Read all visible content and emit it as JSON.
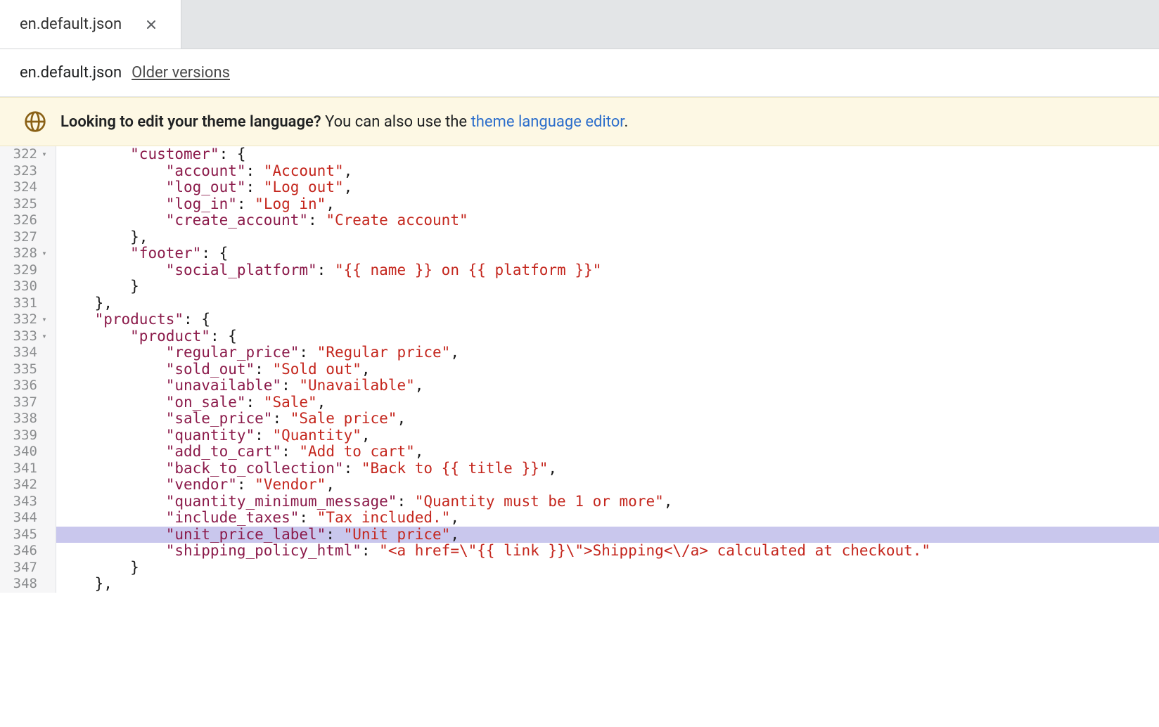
{
  "tab": {
    "label": "en.default.json"
  },
  "breadcrumb": {
    "filename": "en.default.json",
    "older_versions": "Older versions"
  },
  "banner": {
    "strong": "Looking to edit your theme language?",
    "text": " You can also use the ",
    "link": "theme language editor",
    "after": "."
  },
  "editor": {
    "first_line": 322,
    "foldable_lines": [
      322,
      328,
      332,
      333
    ],
    "highlighted_line": 345,
    "lines": [
      {
        "indent": 4,
        "tokens": [
          [
            "key",
            "\"customer\""
          ],
          [
            "pun",
            ": "
          ],
          [
            "pun",
            "{"
          ]
        ]
      },
      {
        "indent": 6,
        "tokens": [
          [
            "key",
            "\"account\""
          ],
          [
            "pun",
            ": "
          ],
          [
            "str",
            "\"Account\""
          ],
          [
            "pun",
            ","
          ]
        ]
      },
      {
        "indent": 6,
        "tokens": [
          [
            "key",
            "\"log_out\""
          ],
          [
            "pun",
            ": "
          ],
          [
            "str",
            "\"Log out\""
          ],
          [
            "pun",
            ","
          ]
        ]
      },
      {
        "indent": 6,
        "tokens": [
          [
            "key",
            "\"log_in\""
          ],
          [
            "pun",
            ": "
          ],
          [
            "str",
            "\"Log in\""
          ],
          [
            "pun",
            ","
          ]
        ]
      },
      {
        "indent": 6,
        "tokens": [
          [
            "key",
            "\"create_account\""
          ],
          [
            "pun",
            ": "
          ],
          [
            "str",
            "\"Create account\""
          ]
        ]
      },
      {
        "indent": 4,
        "tokens": [
          [
            "pun",
            "},"
          ]
        ]
      },
      {
        "indent": 4,
        "tokens": [
          [
            "key",
            "\"footer\""
          ],
          [
            "pun",
            ": "
          ],
          [
            "pun",
            "{"
          ]
        ]
      },
      {
        "indent": 6,
        "tokens": [
          [
            "key",
            "\"social_platform\""
          ],
          [
            "pun",
            ": "
          ],
          [
            "str",
            "\"{{ name }} on {{ platform }}\""
          ]
        ]
      },
      {
        "indent": 4,
        "tokens": [
          [
            "pun",
            "}"
          ]
        ]
      },
      {
        "indent": 2,
        "tokens": [
          [
            "pun",
            "},"
          ]
        ]
      },
      {
        "indent": 2,
        "tokens": [
          [
            "key",
            "\"products\""
          ],
          [
            "pun",
            ": "
          ],
          [
            "pun",
            "{"
          ]
        ]
      },
      {
        "indent": 4,
        "tokens": [
          [
            "key",
            "\"product\""
          ],
          [
            "pun",
            ": "
          ],
          [
            "pun",
            "{"
          ]
        ]
      },
      {
        "indent": 6,
        "tokens": [
          [
            "key",
            "\"regular_price\""
          ],
          [
            "pun",
            ": "
          ],
          [
            "str",
            "\"Regular price\""
          ],
          [
            "pun",
            ","
          ]
        ]
      },
      {
        "indent": 6,
        "tokens": [
          [
            "key",
            "\"sold_out\""
          ],
          [
            "pun",
            ": "
          ],
          [
            "str",
            "\"Sold out\""
          ],
          [
            "pun",
            ","
          ]
        ]
      },
      {
        "indent": 6,
        "tokens": [
          [
            "key",
            "\"unavailable\""
          ],
          [
            "pun",
            ": "
          ],
          [
            "str",
            "\"Unavailable\""
          ],
          [
            "pun",
            ","
          ]
        ]
      },
      {
        "indent": 6,
        "tokens": [
          [
            "key",
            "\"on_sale\""
          ],
          [
            "pun",
            ": "
          ],
          [
            "str",
            "\"Sale\""
          ],
          [
            "pun",
            ","
          ]
        ]
      },
      {
        "indent": 6,
        "tokens": [
          [
            "key",
            "\"sale_price\""
          ],
          [
            "pun",
            ": "
          ],
          [
            "str",
            "\"Sale price\""
          ],
          [
            "pun",
            ","
          ]
        ]
      },
      {
        "indent": 6,
        "tokens": [
          [
            "key",
            "\"quantity\""
          ],
          [
            "pun",
            ": "
          ],
          [
            "str",
            "\"Quantity\""
          ],
          [
            "pun",
            ","
          ]
        ]
      },
      {
        "indent": 6,
        "tokens": [
          [
            "key",
            "\"add_to_cart\""
          ],
          [
            "pun",
            ": "
          ],
          [
            "str",
            "\"Add to cart\""
          ],
          [
            "pun",
            ","
          ]
        ]
      },
      {
        "indent": 6,
        "tokens": [
          [
            "key",
            "\"back_to_collection\""
          ],
          [
            "pun",
            ": "
          ],
          [
            "str",
            "\"Back to {{ title }}\""
          ],
          [
            "pun",
            ","
          ]
        ]
      },
      {
        "indent": 6,
        "tokens": [
          [
            "key",
            "\"vendor\""
          ],
          [
            "pun",
            ": "
          ],
          [
            "str",
            "\"Vendor\""
          ],
          [
            "pun",
            ","
          ]
        ]
      },
      {
        "indent": 6,
        "tokens": [
          [
            "key",
            "\"quantity_minimum_message\""
          ],
          [
            "pun",
            ": "
          ],
          [
            "str",
            "\"Quantity must be 1 or more\""
          ],
          [
            "pun",
            ","
          ]
        ]
      },
      {
        "indent": 6,
        "tokens": [
          [
            "key",
            "\"include_taxes\""
          ],
          [
            "pun",
            ": "
          ],
          [
            "str",
            "\"Tax included.\""
          ],
          [
            "pun",
            ","
          ]
        ]
      },
      {
        "indent": 6,
        "tokens": [
          [
            "key",
            "\"unit_price_label\""
          ],
          [
            "pun",
            ": "
          ],
          [
            "str",
            "\"Unit price\""
          ],
          [
            "pun",
            ","
          ]
        ]
      },
      {
        "indent": 6,
        "tokens": [
          [
            "key",
            "\"shipping_policy_html\""
          ],
          [
            "pun",
            ": "
          ],
          [
            "str",
            "\"<a href=\\\"{{ link }}\\\">Shipping<\\/a> calculated at checkout.\""
          ]
        ]
      },
      {
        "indent": 4,
        "tokens": [
          [
            "pun",
            "}"
          ]
        ]
      },
      {
        "indent": 2,
        "tokens": [
          [
            "pun",
            "},"
          ]
        ]
      }
    ]
  },
  "colors": {
    "key": "#7b173f",
    "str": "#c41a16",
    "pun": "#1a1a1a"
  }
}
